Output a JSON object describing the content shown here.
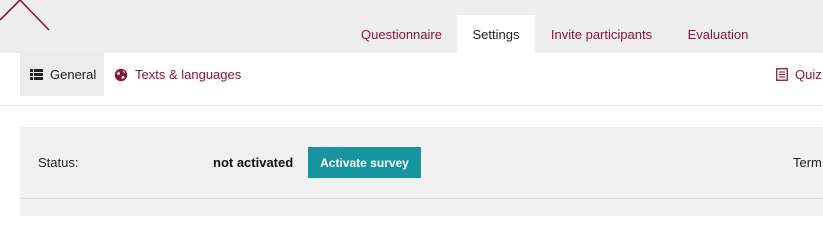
{
  "header": {
    "tabs": [
      {
        "label": "Questionnaire",
        "active": false
      },
      {
        "label": "Settings",
        "active": true
      },
      {
        "label": "Invite participants",
        "active": false
      },
      {
        "label": "Evaluation",
        "active": false
      }
    ]
  },
  "subnav": {
    "general": {
      "label": "General",
      "icon": "list-icon",
      "active": true
    },
    "texts": {
      "label": "Texts & languages",
      "icon": "globe-icon"
    },
    "quiz": {
      "label": "Quiz",
      "icon": "document-icon"
    }
  },
  "status": {
    "label": "Status:",
    "value": "not activated",
    "button_label": "Activate survey",
    "term_label": "Term"
  },
  "colors": {
    "accent": "#8b1538",
    "button": "#17959e",
    "topbar": "#eeeeee",
    "panel": "#f1f1f1"
  }
}
